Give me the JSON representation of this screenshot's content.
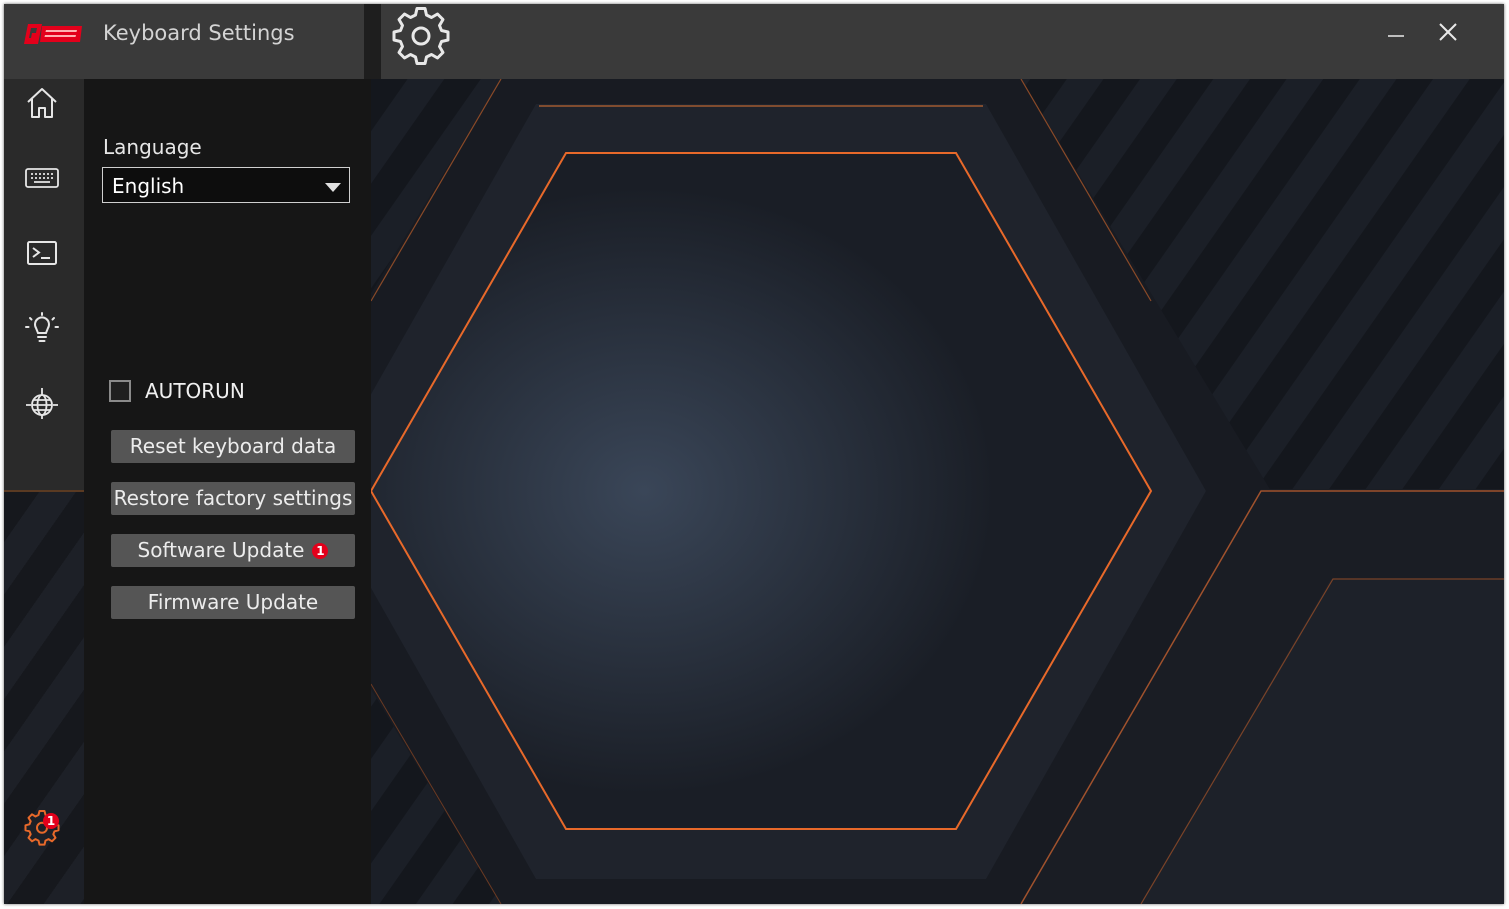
{
  "window": {
    "title": "Keyboard Settings",
    "controls": {
      "minimize": "minimize-icon",
      "close": "close-icon"
    }
  },
  "nav": {
    "items": [
      {
        "icon": "home-icon"
      },
      {
        "icon": "keyboard-icon"
      },
      {
        "icon": "terminal-macro-icon"
      },
      {
        "icon": "lightbulb-icon"
      },
      {
        "icon": "globe-network-icon"
      }
    ],
    "settings": {
      "icon": "gear-icon",
      "badge": "1"
    }
  },
  "settings": {
    "language_label": "Language",
    "language_value": "English",
    "autorun_label": "AUTORUN",
    "autorun_checked": false,
    "buttons": {
      "reset": "Reset keyboard data",
      "restore": "Restore factory settings",
      "software_update": "Software Update",
      "software_update_badge": "1",
      "firmware_update": "Firmware Update"
    }
  },
  "colors": {
    "accent": "#e8692a",
    "badge": "#e3001b",
    "logo": "#e3001b",
    "titlebar": "#3a3a3a"
  }
}
